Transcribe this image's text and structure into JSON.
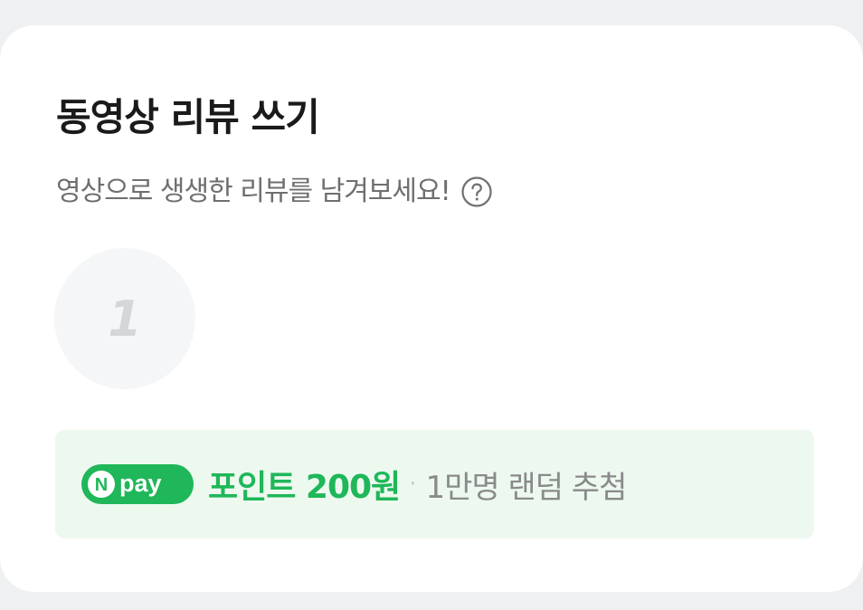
{
  "card": {
    "title": "동영상 리뷰 쓰기",
    "subtitle": "영상으로 생생한 리뷰를 남겨보세요!",
    "help_icon": "question-circle-icon"
  },
  "upload": {
    "slot_number": "1"
  },
  "reward": {
    "logo_n": "N",
    "logo_text": "pay",
    "amount": "포인트 200원",
    "separator": "·",
    "description": "1만명 랜덤 추첨",
    "accent_color": "#1fb759",
    "background_color": "#edf9ef"
  }
}
